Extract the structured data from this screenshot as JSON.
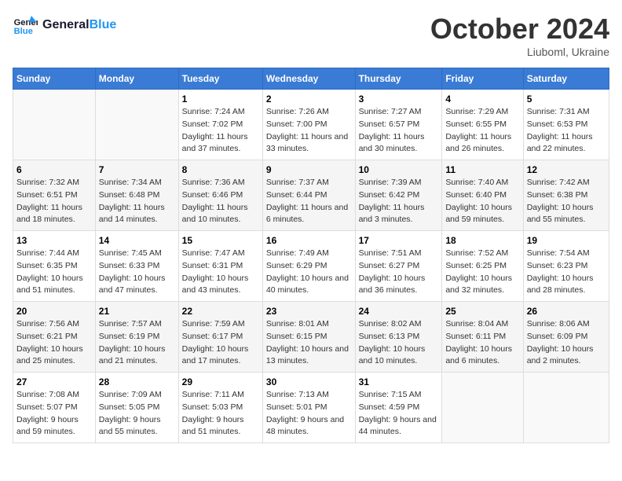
{
  "logo": {
    "text_general": "General",
    "text_blue": "Blue"
  },
  "header": {
    "month": "October 2024",
    "location": "Liuboml, Ukraine"
  },
  "days_of_week": [
    "Sunday",
    "Monday",
    "Tuesday",
    "Wednesday",
    "Thursday",
    "Friday",
    "Saturday"
  ],
  "weeks": [
    [
      {
        "day": "",
        "info": ""
      },
      {
        "day": "",
        "info": ""
      },
      {
        "day": "1",
        "sunrise": "Sunrise: 7:24 AM",
        "sunset": "Sunset: 7:02 PM",
        "daylight": "Daylight: 11 hours and 37 minutes."
      },
      {
        "day": "2",
        "sunrise": "Sunrise: 7:26 AM",
        "sunset": "Sunset: 7:00 PM",
        "daylight": "Daylight: 11 hours and 33 minutes."
      },
      {
        "day": "3",
        "sunrise": "Sunrise: 7:27 AM",
        "sunset": "Sunset: 6:57 PM",
        "daylight": "Daylight: 11 hours and 30 minutes."
      },
      {
        "day": "4",
        "sunrise": "Sunrise: 7:29 AM",
        "sunset": "Sunset: 6:55 PM",
        "daylight": "Daylight: 11 hours and 26 minutes."
      },
      {
        "day": "5",
        "sunrise": "Sunrise: 7:31 AM",
        "sunset": "Sunset: 6:53 PM",
        "daylight": "Daylight: 11 hours and 22 minutes."
      }
    ],
    [
      {
        "day": "6",
        "sunrise": "Sunrise: 7:32 AM",
        "sunset": "Sunset: 6:51 PM",
        "daylight": "Daylight: 11 hours and 18 minutes."
      },
      {
        "day": "7",
        "sunrise": "Sunrise: 7:34 AM",
        "sunset": "Sunset: 6:48 PM",
        "daylight": "Daylight: 11 hours and 14 minutes."
      },
      {
        "day": "8",
        "sunrise": "Sunrise: 7:36 AM",
        "sunset": "Sunset: 6:46 PM",
        "daylight": "Daylight: 11 hours and 10 minutes."
      },
      {
        "day": "9",
        "sunrise": "Sunrise: 7:37 AM",
        "sunset": "Sunset: 6:44 PM",
        "daylight": "Daylight: 11 hours and 6 minutes."
      },
      {
        "day": "10",
        "sunrise": "Sunrise: 7:39 AM",
        "sunset": "Sunset: 6:42 PM",
        "daylight": "Daylight: 11 hours and 3 minutes."
      },
      {
        "day": "11",
        "sunrise": "Sunrise: 7:40 AM",
        "sunset": "Sunset: 6:40 PM",
        "daylight": "Daylight: 10 hours and 59 minutes."
      },
      {
        "day": "12",
        "sunrise": "Sunrise: 7:42 AM",
        "sunset": "Sunset: 6:38 PM",
        "daylight": "Daylight: 10 hours and 55 minutes."
      }
    ],
    [
      {
        "day": "13",
        "sunrise": "Sunrise: 7:44 AM",
        "sunset": "Sunset: 6:35 PM",
        "daylight": "Daylight: 10 hours and 51 minutes."
      },
      {
        "day": "14",
        "sunrise": "Sunrise: 7:45 AM",
        "sunset": "Sunset: 6:33 PM",
        "daylight": "Daylight: 10 hours and 47 minutes."
      },
      {
        "day": "15",
        "sunrise": "Sunrise: 7:47 AM",
        "sunset": "Sunset: 6:31 PM",
        "daylight": "Daylight: 10 hours and 43 minutes."
      },
      {
        "day": "16",
        "sunrise": "Sunrise: 7:49 AM",
        "sunset": "Sunset: 6:29 PM",
        "daylight": "Daylight: 10 hours and 40 minutes."
      },
      {
        "day": "17",
        "sunrise": "Sunrise: 7:51 AM",
        "sunset": "Sunset: 6:27 PM",
        "daylight": "Daylight: 10 hours and 36 minutes."
      },
      {
        "day": "18",
        "sunrise": "Sunrise: 7:52 AM",
        "sunset": "Sunset: 6:25 PM",
        "daylight": "Daylight: 10 hours and 32 minutes."
      },
      {
        "day": "19",
        "sunrise": "Sunrise: 7:54 AM",
        "sunset": "Sunset: 6:23 PM",
        "daylight": "Daylight: 10 hours and 28 minutes."
      }
    ],
    [
      {
        "day": "20",
        "sunrise": "Sunrise: 7:56 AM",
        "sunset": "Sunset: 6:21 PM",
        "daylight": "Daylight: 10 hours and 25 minutes."
      },
      {
        "day": "21",
        "sunrise": "Sunrise: 7:57 AM",
        "sunset": "Sunset: 6:19 PM",
        "daylight": "Daylight: 10 hours and 21 minutes."
      },
      {
        "day": "22",
        "sunrise": "Sunrise: 7:59 AM",
        "sunset": "Sunset: 6:17 PM",
        "daylight": "Daylight: 10 hours and 17 minutes."
      },
      {
        "day": "23",
        "sunrise": "Sunrise: 8:01 AM",
        "sunset": "Sunset: 6:15 PM",
        "daylight": "Daylight: 10 hours and 13 minutes."
      },
      {
        "day": "24",
        "sunrise": "Sunrise: 8:02 AM",
        "sunset": "Sunset: 6:13 PM",
        "daylight": "Daylight: 10 hours and 10 minutes."
      },
      {
        "day": "25",
        "sunrise": "Sunrise: 8:04 AM",
        "sunset": "Sunset: 6:11 PM",
        "daylight": "Daylight: 10 hours and 6 minutes."
      },
      {
        "day": "26",
        "sunrise": "Sunrise: 8:06 AM",
        "sunset": "Sunset: 6:09 PM",
        "daylight": "Daylight: 10 hours and 2 minutes."
      }
    ],
    [
      {
        "day": "27",
        "sunrise": "Sunrise: 7:08 AM",
        "sunset": "Sunset: 5:07 PM",
        "daylight": "Daylight: 9 hours and 59 minutes."
      },
      {
        "day": "28",
        "sunrise": "Sunrise: 7:09 AM",
        "sunset": "Sunset: 5:05 PM",
        "daylight": "Daylight: 9 hours and 55 minutes."
      },
      {
        "day": "29",
        "sunrise": "Sunrise: 7:11 AM",
        "sunset": "Sunset: 5:03 PM",
        "daylight": "Daylight: 9 hours and 51 minutes."
      },
      {
        "day": "30",
        "sunrise": "Sunrise: 7:13 AM",
        "sunset": "Sunset: 5:01 PM",
        "daylight": "Daylight: 9 hours and 48 minutes."
      },
      {
        "day": "31",
        "sunrise": "Sunrise: 7:15 AM",
        "sunset": "Sunset: 4:59 PM",
        "daylight": "Daylight: 9 hours and 44 minutes."
      },
      {
        "day": "",
        "info": ""
      },
      {
        "day": "",
        "info": ""
      }
    ]
  ]
}
